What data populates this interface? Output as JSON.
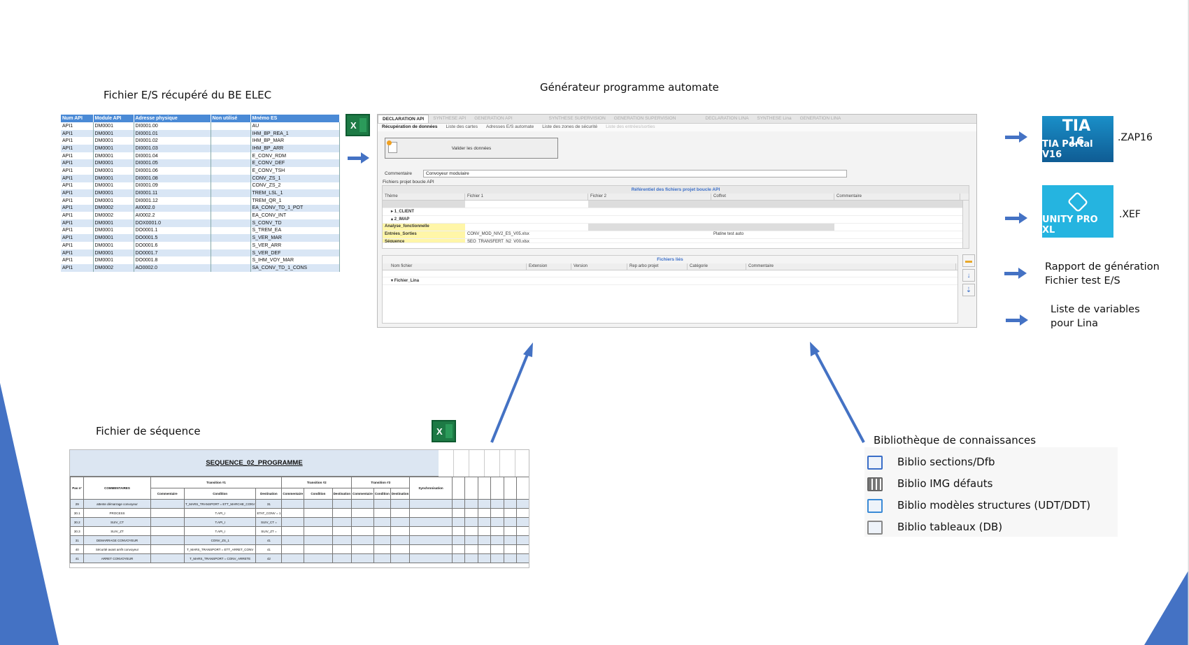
{
  "captions": {
    "fichier_es": "Fichier E/S récupéré du BE ELEC",
    "generateur": "Générateur programme automate",
    "fichier_sequence": "Fichier de séquence",
    "bibliotheque": "Bibliothèque de connaissances"
  },
  "excel_icon": "X",
  "es_table": {
    "headers": [
      "Num API",
      "Module API",
      "Adresse physique",
      "Non utilisé",
      "Mnémo ES"
    ],
    "rows": [
      [
        "API1",
        "DM0001",
        "DI0001.00",
        "",
        "AU"
      ],
      [
        "API1",
        "DM0001",
        "DI0001.01",
        "",
        "IHM_BP_REA_1"
      ],
      [
        "API1",
        "DM0001",
        "DI0001.02",
        "",
        "IHM_BP_MAR"
      ],
      [
        "API1",
        "DM0001",
        "DI0001.03",
        "",
        "IHM_BP_ARR"
      ],
      [
        "API1",
        "DM0001",
        "DI0001.04",
        "",
        "E_CONV_RDM"
      ],
      [
        "API1",
        "DM0001",
        "DI0001.05",
        "",
        "E_CONV_DEF"
      ],
      [
        "API1",
        "DM0001",
        "DI0001.06",
        "",
        "E_CONV_TSH"
      ],
      [
        "API1",
        "DM0001",
        "DI0001.08",
        "",
        "CONV_ZS_1"
      ],
      [
        "API1",
        "DM0001",
        "DI0001.09",
        "",
        "CONV_ZS_2"
      ],
      [
        "API1",
        "DM0001",
        "DI0001.11",
        "",
        "TREM_LSL_1"
      ],
      [
        "API1",
        "DM0001",
        "DI0001.12",
        "",
        "TREM_QR_1"
      ],
      [
        "API1",
        "DM0002",
        "AI0002.0",
        "",
        "EA_CONV_TD_1_POT"
      ],
      [
        "API1",
        "DM0002",
        "AI0002.2",
        "",
        "EA_CONV_INT"
      ],
      [
        "API1",
        "DM0001",
        "DOX0001.0",
        "",
        "S_CONV_TD"
      ],
      [
        "API1",
        "DM0001",
        "DO0001.1",
        "",
        "S_TREM_EA"
      ],
      [
        "API1",
        "DM0001",
        "DO0001.5",
        "",
        "S_VER_MAR"
      ],
      [
        "API1",
        "DM0001",
        "DO0001.6",
        "",
        "S_VER_ARR"
      ],
      [
        "API1",
        "DM0001",
        "DO0001.7",
        "",
        "S_VER_DEF"
      ],
      [
        "API1",
        "DM0001",
        "DO0001.8",
        "",
        "S_IHM_VOY_MAR"
      ],
      [
        "API1",
        "DM0002",
        "AO0002.0",
        "",
        "SA_CONV_TD_1_CONS"
      ]
    ]
  },
  "generator": {
    "tabs": [
      "DECLARATION API",
      "SYNTHESE API",
      "GENERATION API",
      "SYNTHESE SUPERVISION",
      "GENERATION SUPERVISION",
      "DECLARATION LINA",
      "SYNTHESE Lina",
      "GENERATION LINA"
    ],
    "subtabs": [
      "Récupération de données",
      "Liste des cartes",
      "Adresses E/S automate",
      "Liste des zones de sécurité",
      "Liste des entrées/sorties"
    ],
    "validate_button": "Valider les données",
    "comment_label": "Commentaire",
    "comment_value": "Convoyeur modulaire",
    "group_label": "Fichiers projet boucle API",
    "ref_panel_title": "Référentiel des fichiers projet boucle API",
    "ref_columns": [
      "Thème",
      "Fichier 1",
      "Fichier 2",
      "Coffret",
      "Commentaire"
    ],
    "ref_rows": [
      "1_CLIENT",
      "2_IMAP",
      "Analyse_fonctionnelle",
      "Entrées_Sorties",
      "Séquence"
    ],
    "ref_file": "CONV_MOD_NIV2_ES_V05.xlsx",
    "ref_file2": "SEQ_TRANSFERT_N2_V00.xlsx",
    "ref_coffret": "Platine test auto",
    "linked_title": "Fichiers liés",
    "linked_columns": [
      "Nom fichier",
      "Extension",
      "Version",
      "Rep arbo projet",
      "Catégorie",
      "Commentaire"
    ],
    "linked_row": "Fichier_Lina"
  },
  "outputs": {
    "tia_logo_top": "TIA",
    "tia_logo_num": "16",
    "tia_logo": "TIA Portal V16",
    "tia_ext": ".ZAP16",
    "unity_logo": "UNITY PRO XL",
    "unity_ext": ".XEF",
    "report_line1": "Rapport de génération",
    "report_line2": "Fichier test E/S",
    "lina_line1": "Liste de variables",
    "lina_line2": "pour Lina"
  },
  "sequence": {
    "title": "SEQUENCE_02_PROGRAMME",
    "col_headers": [
      "Pas n°",
      "COMMENTAIRES",
      "Transition #1",
      "Transition #2",
      "Transition #3",
      "Synchronisation"
    ],
    "sub_headers": [
      "Commentaire",
      "Condition",
      "Destination"
    ],
    "rows": [
      [
        "29",
        "attente démarrage convoyeur",
        "T_MARS_TRANSPORT = ETT_MARCHE_CONV",
        "31"
      ],
      [
        "30.1",
        "PROCESS",
        "T.API_I",
        "ETAT_CONV = 1"
      ],
      [
        "30.2",
        "SUIV_CT",
        "T.API_I",
        "SUIV_CT ="
      ],
      [
        "30.3",
        "SUIV_ZT",
        "T.API_I",
        "SUIV_ZT ="
      ],
      [
        "31",
        "DEMARRAGE CONVOYEUR",
        "CONV_ZS_1",
        "41"
      ],
      [
        "40",
        "Sécurité avant arrêt convoyeur",
        "T_MARS_TRANSPORT = ETT_ARRET_CONV",
        "41"
      ],
      [
        "41",
        "ARRET CONVOYEUR",
        "T_MARS_TRANSPORT = CONV_ARRETE",
        "42"
      ]
    ]
  },
  "bibliotheque": {
    "items": [
      {
        "label": "Biblio sections/Dfb",
        "icon": "sections-icon"
      },
      {
        "label": "Biblio IMG défauts",
        "icon": "grid-icon"
      },
      {
        "label": "Biblio modèles structures (UDT/DDT)",
        "icon": "structure-icon"
      },
      {
        "label": "Biblio tableaux (DB)",
        "icon": "table-icon"
      }
    ]
  },
  "colors": {
    "accent": "#4472c4",
    "excel_header": "#4a8ad6",
    "excel_green": "#1d7a45",
    "tia": "#0f5c94",
    "unity": "#25b4e0"
  }
}
